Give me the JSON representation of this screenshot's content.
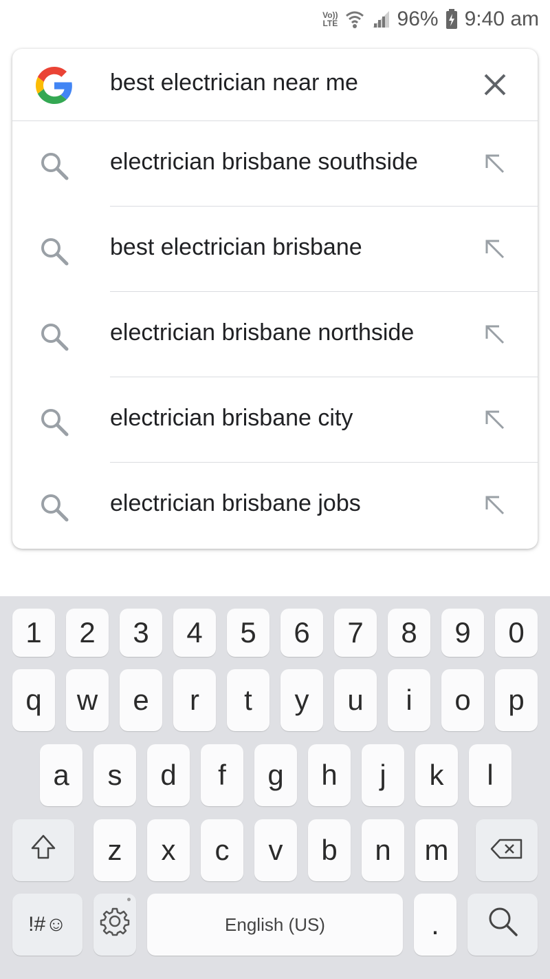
{
  "status_bar": {
    "volte_line1": "Vo))",
    "volte_line2": "LTE",
    "battery": "96%",
    "time": "9:40 am"
  },
  "search": {
    "query": "best electrician near me",
    "logo_icon": "google-g-icon",
    "clear_icon": "close-icon"
  },
  "suggestions": [
    {
      "text": "electrician brisbane southside",
      "icon": "search-icon",
      "action_icon": "arrow-up-left-icon"
    },
    {
      "text": "best electrician brisbane",
      "icon": "search-icon",
      "action_icon": "arrow-up-left-icon"
    },
    {
      "text": "electrician brisbane northside",
      "icon": "search-icon",
      "action_icon": "arrow-up-left-icon"
    },
    {
      "text": "electrician brisbane city",
      "icon": "search-icon",
      "action_icon": "arrow-up-left-icon"
    },
    {
      "text": "electrician brisbane jobs",
      "icon": "search-icon",
      "action_icon": "arrow-up-left-icon"
    }
  ],
  "keyboard": {
    "row_numbers": [
      "1",
      "2",
      "3",
      "4",
      "5",
      "6",
      "7",
      "8",
      "9",
      "0"
    ],
    "row_1": [
      "q",
      "w",
      "e",
      "r",
      "t",
      "y",
      "u",
      "i",
      "o",
      "p"
    ],
    "row_2": [
      "a",
      "s",
      "d",
      "f",
      "g",
      "h",
      "j",
      "k",
      "l"
    ],
    "row_3": [
      "z",
      "x",
      "c",
      "v",
      "b",
      "n",
      "m"
    ],
    "symbols_label": "!#☺",
    "space_label": "English (US)",
    "period_label": ".",
    "shift_icon": "shift-icon",
    "backspace_icon": "backspace-icon",
    "settings_icon": "gear-icon",
    "search_icon": "search-icon"
  },
  "colors": {
    "keyboard_bg": "#dfe0e4",
    "key_bg": "#fbfbfc",
    "google_blue": "#4285F4",
    "google_red": "#EA4335",
    "google_yellow": "#FBBC05",
    "google_green": "#34A853"
  }
}
